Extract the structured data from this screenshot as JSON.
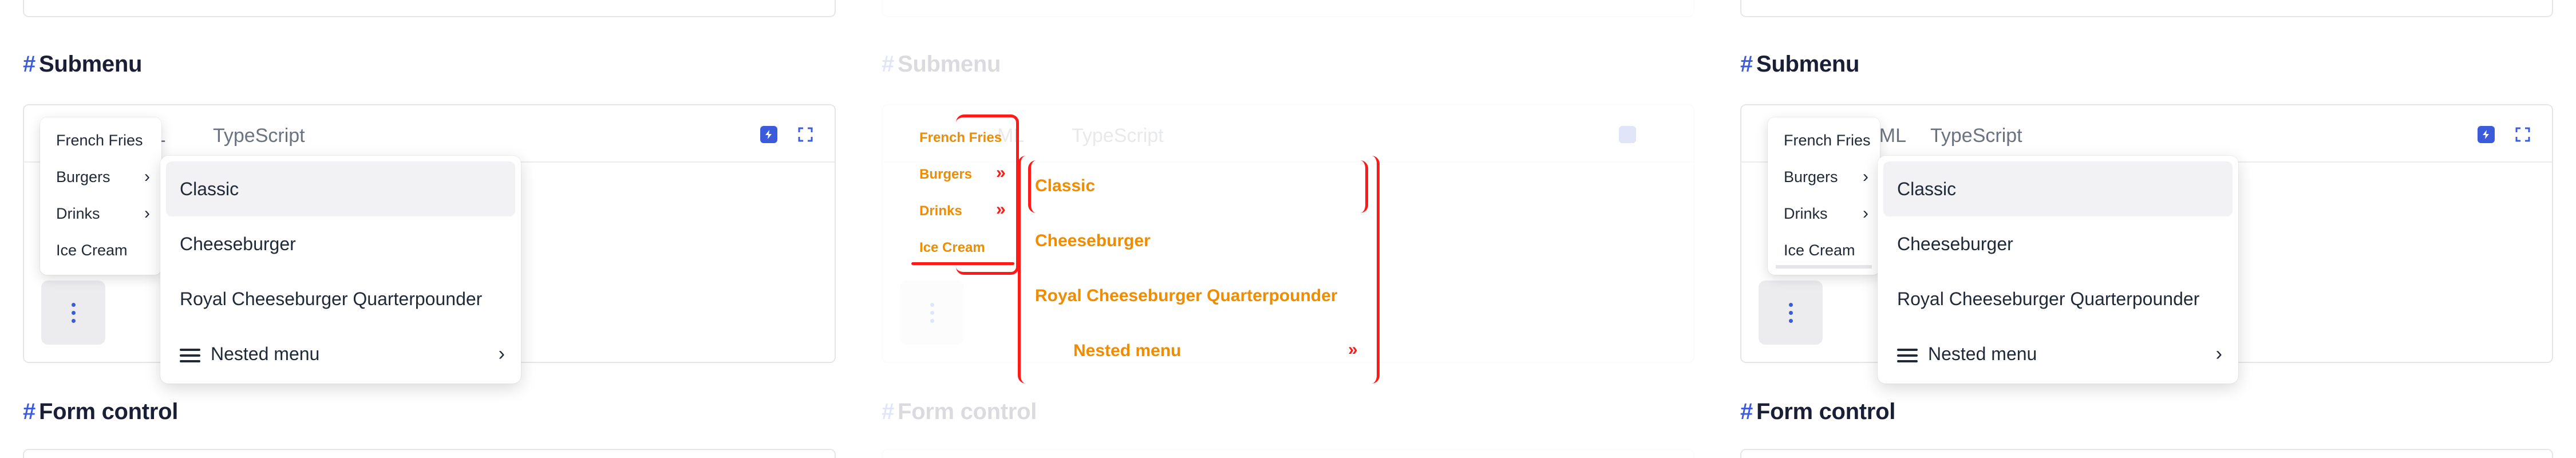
{
  "sections": {
    "submenu_title": "Submenu",
    "form_title": "Form control",
    "hash": "#"
  },
  "tabs": {
    "html_partial": "ML",
    "html_partial_p3": "TML",
    "typescript": "TypeScript"
  },
  "menu": {
    "items": [
      "French Fries",
      "Burgers",
      "Drinks",
      "Ice Cream"
    ]
  },
  "submenu": {
    "items": [
      "Classic",
      "Cheeseburger",
      "Royal Cheeseburger Quarterpounder",
      "Nested menu"
    ]
  },
  "colors": {
    "accent": "#3b5bdb",
    "outline_red": "#ff1a1a",
    "outline_orange": "#f08c00"
  },
  "icons": {
    "chevron": "›",
    "double_chevron": "»"
  }
}
